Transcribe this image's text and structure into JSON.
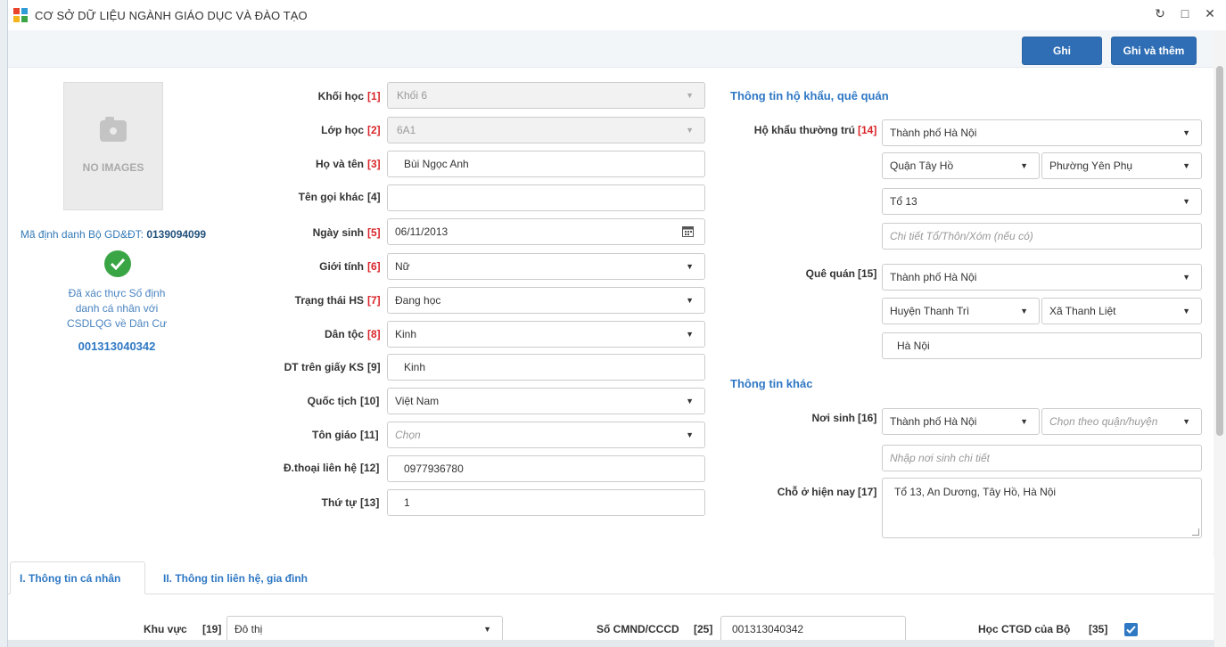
{
  "window": {
    "title": "CƠ SỞ DỮ LIỆU NGÀNH GIÁO DỤC VÀ ĐÀO TẠO",
    "controls": {
      "refresh": "↻",
      "maximize": "□",
      "close": "✕"
    }
  },
  "toolbar": {
    "save_label": "Ghi",
    "save_add_label": "Ghi và thêm"
  },
  "photo": {
    "no_image_text": "NO IMAGES"
  },
  "identity": {
    "ma_dinh_danh_label": "Mã định danh Bộ GD&ĐT:",
    "ma_dinh_danh_value": "0139094099",
    "verify_line1": "Đã xác thực Số định",
    "verify_line2": "danh cá nhân với",
    "verify_line3": "CSDLQG về Dân Cư",
    "verify_number": "001313040342"
  },
  "form_left": {
    "khoi_hoc": {
      "label": "Khối học",
      "num": "[1]",
      "value": "Khối 6"
    },
    "lop_hoc": {
      "label": "Lớp học",
      "num": "[2]",
      "value": "6A1"
    },
    "ho_ten": {
      "label": "Họ và tên",
      "num": "[3]",
      "value": "Bùi Ngọc Anh"
    },
    "ten_goi_khac": {
      "label": "Tên gọi khác",
      "num": "[4]",
      "value": ""
    },
    "ngay_sinh": {
      "label": "Ngày sinh",
      "num": "[5]",
      "value": "06/11/2013"
    },
    "gioi_tinh": {
      "label": "Giới tính",
      "num": "[6]",
      "value": "Nữ"
    },
    "trang_thai": {
      "label": "Trạng thái HS",
      "num": "[7]",
      "value": "Đang học"
    },
    "dan_toc": {
      "label": "Dân tộc",
      "num": "[8]",
      "value": "Kinh"
    },
    "dt_giay_ks": {
      "label": "DT trên giấy KS",
      "num": "[9]",
      "value": "Kinh"
    },
    "quoc_tich": {
      "label": "Quốc tịch",
      "num": "[10]",
      "value": "Việt Nam"
    },
    "ton_giao": {
      "label": "Tôn giáo",
      "num": "[11]",
      "placeholder": "Chọn"
    },
    "dien_thoai": {
      "label": "Đ.thoại liên hệ",
      "num": "[12]",
      "value": "0977936780"
    },
    "thu_tu": {
      "label": "Thứ tự",
      "num": "[13]",
      "value": "1"
    }
  },
  "form_right": {
    "section_ho_khau": "Thông tin hộ khẩu, quê quán",
    "ho_khau": {
      "label": "Hộ khẩu thường trú",
      "num": "[14]",
      "tinh": "Thành phố Hà Nội",
      "quan": "Quận Tây Hồ",
      "phuong": "Phường Yên Phụ",
      "to": "Tổ 13",
      "chi_tiet_placeholder": "Chi tiết Tổ/Thôn/Xóm (nếu có)"
    },
    "que_quan": {
      "label": "Quê quán",
      "num": "[15]",
      "tinh": "Thành phố Hà Nội",
      "huyen": "Huyện Thanh Trì",
      "xa": "Xã Thanh Liệt",
      "chi_tiet": "Hà Nội"
    },
    "section_khac": "Thông tin khác",
    "noi_sinh": {
      "label": "Nơi sinh",
      "num": "[16]",
      "tinh": "Thành phố Hà Nội",
      "quan_placeholder": "Chọn theo quận/huyện",
      "chi_tiet_placeholder": "Nhập nơi sinh chi tiết"
    },
    "cho_o": {
      "label": "Chỗ ở hiện nay",
      "num": "[17]",
      "value": "Tổ 13, An Dương, Tây Hồ, Hà Nội"
    }
  },
  "tabs": [
    {
      "label": "I. Thông tin cá nhân"
    },
    {
      "label": "II. Thông tin liên hệ, gia đình"
    }
  ],
  "bottom": {
    "khu_vuc": {
      "label": "Khu vực",
      "num": "[19]",
      "value": "Đô thị"
    },
    "cmnd": {
      "label": "Số CMND/CCCD",
      "num": "[25]",
      "value": "001313040342"
    },
    "hoc_ctgd": {
      "label": "Học CTGD của Bộ",
      "num": "[35]",
      "checked": true
    }
  }
}
